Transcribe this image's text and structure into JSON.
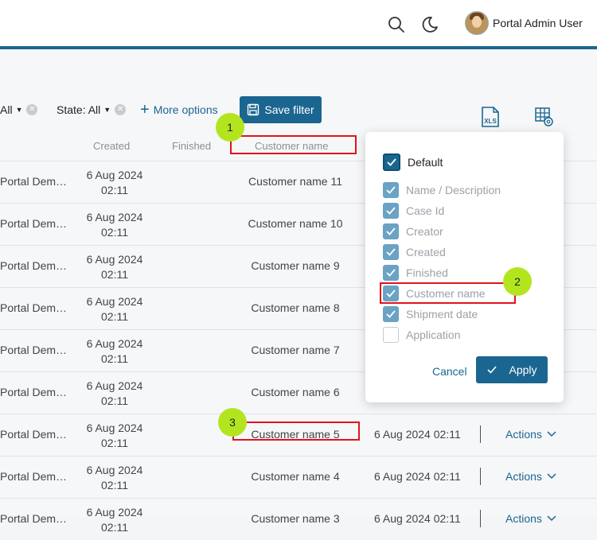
{
  "header": {
    "user_name": "Portal Admin User"
  },
  "filters": {
    "all_label": "All",
    "state_label": "State: All",
    "more_options": "More options",
    "save_filter": "Save filter"
  },
  "columns": {
    "created": "Created",
    "finished": "Finished",
    "customer_name": "Customer name"
  },
  "rows": [
    {
      "creator": "Portal Demo User",
      "date1": "6 Aug 2024",
      "date2": "02:11",
      "customer": "Customer name 11",
      "shipment": "",
      "actions": ""
    },
    {
      "creator": "Portal Demo User",
      "date1": "6 Aug 2024",
      "date2": "02:11",
      "customer": "Customer name 10",
      "shipment": "",
      "actions": ""
    },
    {
      "creator": "Portal Demo User",
      "date1": "6 Aug 2024",
      "date2": "02:11",
      "customer": "Customer name 9",
      "shipment": "",
      "actions": ""
    },
    {
      "creator": "Portal Demo User",
      "date1": "6 Aug 2024",
      "date2": "02:11",
      "customer": "Customer name 8",
      "shipment": "",
      "actions": ""
    },
    {
      "creator": "Portal Demo User",
      "date1": "6 Aug 2024",
      "date2": "02:11",
      "customer": "Customer name 7",
      "shipment": "",
      "actions": ""
    },
    {
      "creator": "Portal Demo User",
      "date1": "6 Aug 2024",
      "date2": "02:11",
      "customer": "Customer name 6",
      "shipment": "",
      "actions": ""
    },
    {
      "creator": "Portal Demo User",
      "date1": "6 Aug 2024",
      "date2": "02:11",
      "customer": "Customer name 5",
      "shipment": "6 Aug 2024 02:11",
      "actions": "Actions"
    },
    {
      "creator": "Portal Demo User",
      "date1": "6 Aug 2024",
      "date2": "02:11",
      "customer": "Customer name 4",
      "shipment": "6 Aug 2024 02:11",
      "actions": "Actions"
    },
    {
      "creator": "Portal Demo User",
      "date1": "6 Aug 2024",
      "date2": "02:11",
      "customer": "Customer name 3",
      "shipment": "6 Aug 2024 02:11",
      "actions": "Actions"
    }
  ],
  "column_config": {
    "default_label": "Default",
    "items": [
      {
        "label": "Name / Description",
        "checked": true
      },
      {
        "label": "Case Id",
        "checked": true
      },
      {
        "label": "Creator",
        "checked": true
      },
      {
        "label": "Created",
        "checked": true
      },
      {
        "label": "Finished",
        "checked": true
      },
      {
        "label": "Customer name",
        "checked": true
      },
      {
        "label": "Shipment date",
        "checked": true
      },
      {
        "label": "Application",
        "checked": false
      }
    ],
    "cancel": "Cancel",
    "apply": "Apply"
  },
  "annotations": [
    "1",
    "2",
    "3"
  ],
  "icons": {
    "search": "search-icon",
    "theme": "moon-icon",
    "save": "floppy-disk-icon",
    "export": "xls-export-icon",
    "columns": "table-settings-icon",
    "xls_text": "XLS"
  },
  "colors": {
    "primary": "#1b6690",
    "annotation_badge": "#b3e51f",
    "annotation_box": "#e0141b"
  }
}
